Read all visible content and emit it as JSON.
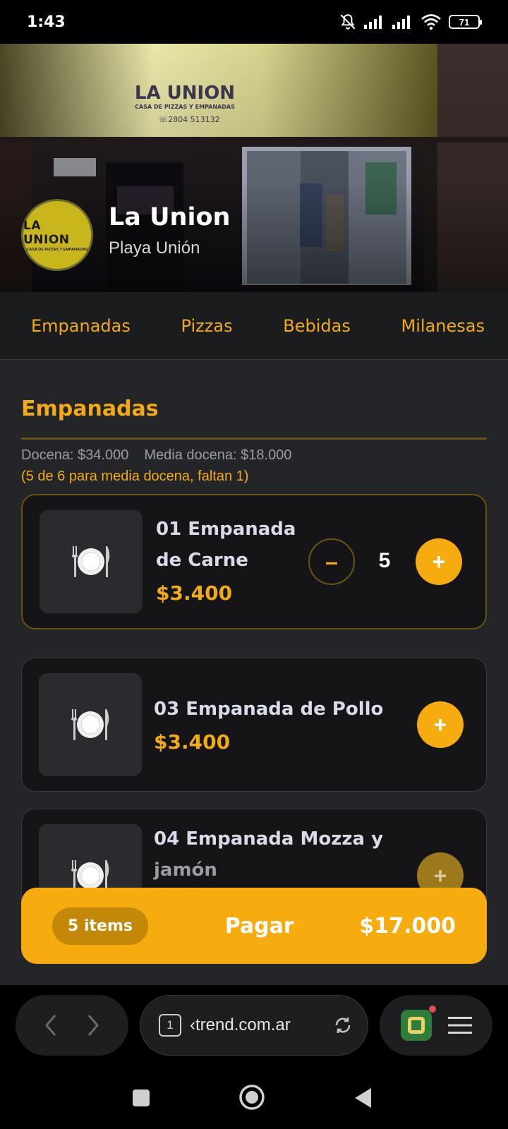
{
  "status_bar": {
    "time": "1:43",
    "battery": "71"
  },
  "hero": {
    "store_name": "La Union",
    "location": "Playa Unión",
    "avatar_logo_text": "LA UNION",
    "avatar_logo_sub": "CASA DE PIZZAS Y EMPANADAS",
    "sign_text": "LA UNION",
    "sign_sub": "CASA DE PIZZAS Y EMPANADAS",
    "sign_phone": "2804 513132"
  },
  "tabs": [
    {
      "label": "Empanadas"
    },
    {
      "label": "Pizzas"
    },
    {
      "label": "Bebidas"
    },
    {
      "label": "Milanesas"
    }
  ],
  "section": {
    "title": "Empanadas",
    "dozen_price": "Docena: $34.000",
    "half_dozen_price": "Media docena: $18.000",
    "progress_note": "(5 de 6 para media docena, faltan 1)"
  },
  "items": [
    {
      "name_line1": "01 Empanada",
      "name_line2": "de Carne",
      "price": "$3.400",
      "quantity": "5",
      "minus": "–",
      "plus": "+"
    },
    {
      "name_line1": "03 Empanada de Pollo",
      "price": "$3.400",
      "plus": "+"
    },
    {
      "name_line1": "04 Empanada Mozza y",
      "name_line2": "jamón",
      "plus": "+"
    }
  ],
  "cart": {
    "count_label": "5 items",
    "pay_label": "Pagar",
    "total": "$17.000"
  },
  "browser": {
    "tab_count": "1",
    "url": "‹trend.com.ar"
  },
  "colors": {
    "accent": "#f6ab0e",
    "background": "#242528",
    "card": "#151517"
  }
}
